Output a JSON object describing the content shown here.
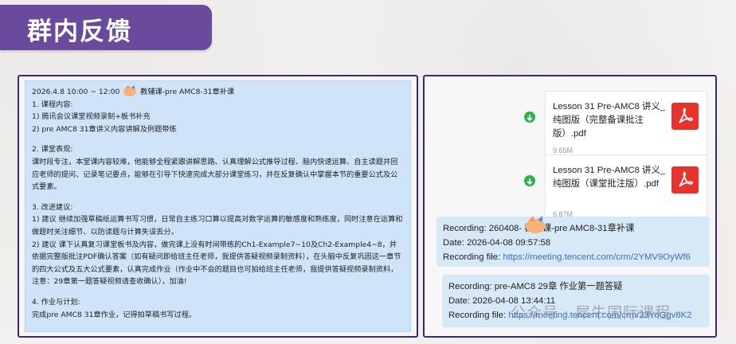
{
  "header": {
    "title": "群内反馈"
  },
  "left": {
    "title_time": "2026.4.8   10:00 ~ 12:00",
    "title_course": "教辅课-pre AMC8-31章补课",
    "sec1_heading": "1. 课程内容:",
    "sec1_items": [
      "1)  腾讯会议课堂视频录制+板书补充",
      "2)  pre AMC8 31章讲义内容讲解及例题带练"
    ],
    "sec2_heading": "2.   课堂表现:",
    "sec2_body": "  课时段专注，本堂课内容较难，他能够全程紧跟讲解思路、认真理解公式推导过程、脑内快速运算、自主读题并回应老师的提问、记录笔记要点，能够在引导下快速完成大部分课堂练习，并在反复确认中掌握本节的重要公式及公式要素。",
    "sec3_heading": "3. 改进建议:",
    "sec3_item1": "1)  建议    继续加强草稿纸运算书写习惯，日常自主练习口算以提高对数字运算的敏感度和熟练度，同时注意在运算和做题时关注细节、以防读题与计算失误丢分。",
    "sec3_item2": "2)  建议    课下认真复习课堂板书及内容，做完课上没有时间带练的Ch1-Example7~10及Ch2-Example4~8，并依据完整版批注PDF确认答案（如有疑问即给班主任老师，我提供答疑视频录制资料），在头脑中反复巩固这一章节的四大公式及五大公式要素，认真完成作业（作业中不会的题目也可拍给班主任老师，我提供答疑视频录制资料，注意：29章第一题答疑视频请查收确认），加油!",
    "sec4_heading": "4. 作业与计划:",
    "sec4_body": "完成pre AMC8 31章作业，记得拍草稿书写过程。"
  },
  "files": [
    {
      "name": "Lesson 31 Pre-AMC8 讲义_纯图版（完整备课批注版）.pdf",
      "size": "9.65M",
      "icon": "pdf-icon"
    },
    {
      "name": "Lesson 31 Pre-AMC8 讲义_纯图版（课堂批注版）.pdf",
      "size": "6.87M",
      "icon": "pdf-icon"
    }
  ],
  "recordings": [
    {
      "title": "Recording: 260408-     教辅课-pre AMC8-31章补课",
      "date": "Date: 2026-04-08 09:57:58",
      "file_label": "Recording file:",
      "file_url": "https://meeting.tencent.com/crm/2YMV9OyWf6"
    },
    {
      "title": "Recording: pre-AMC8 29章 作业第一题答疑",
      "date": "Date: 2026-04-08 13:44:11",
      "file_label": "Recording file:",
      "file_url": "https://meeting.tencent.com/crm/23YoGgv8K2"
    }
  ],
  "watermark": "公众号 · 犀牛国际课程",
  "colors": {
    "header": "#6a4a9d",
    "border": "#3b2a6b",
    "chat_bubble": "#cfe4f9",
    "link": "#3a6fc6",
    "pdf": "#e8322b",
    "download": "#2db14a"
  }
}
